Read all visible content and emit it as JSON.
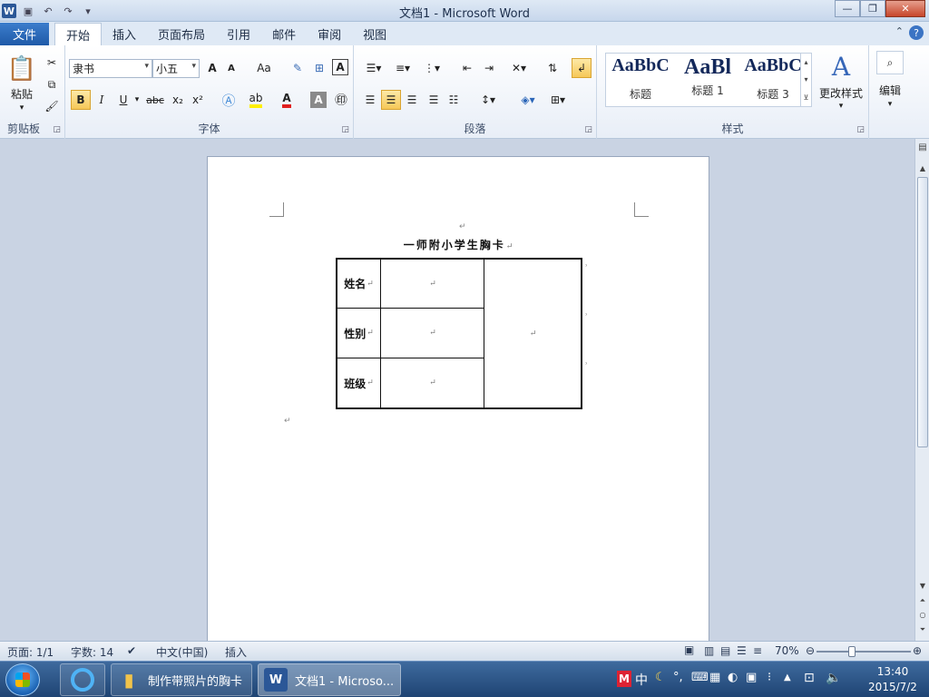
{
  "window": {
    "title": "文档1 - Microsoft Word",
    "app_icon": "W"
  },
  "ribbon_tabs": {
    "file": "文件",
    "items": [
      "开始",
      "插入",
      "页面布局",
      "引用",
      "邮件",
      "审阅",
      "视图"
    ],
    "active": "开始"
  },
  "clipboard": {
    "paste": "粘贴",
    "label": "剪贴板"
  },
  "font": {
    "family": "隶书",
    "size": "小五",
    "grow": "A",
    "shrink": "A",
    "case": "Aa",
    "clear": "A",
    "bold": "B",
    "italic": "I",
    "underline": "U",
    "strike": "abc",
    "sub": "x₂",
    "sup": "x²",
    "color_glyph": "A",
    "label": "字体"
  },
  "paragraph": {
    "label": "段落"
  },
  "styles": {
    "items": [
      {
        "preview": "AaBbC",
        "name": "标题"
      },
      {
        "preview": "AaBl",
        "name": "标题 1"
      },
      {
        "preview": "AaBbC",
        "name": "标题 3"
      }
    ],
    "change": "更改样式",
    "label": "样式"
  },
  "editing": {
    "label": "编辑"
  },
  "document": {
    "title": "一师附小学生胸卡",
    "rows": [
      {
        "label": "姓名"
      },
      {
        "label": "性别"
      },
      {
        "label": "班级"
      }
    ]
  },
  "statusbar": {
    "page": "页面: 1/1",
    "words": "字数: 14",
    "language": "中文(中国)",
    "mode": "插入",
    "zoom": "70%"
  },
  "taskbar": {
    "items": [
      {
        "label": "制作带照片的胸卡"
      },
      {
        "label": "文档1 - Microso..."
      }
    ],
    "ime": "中",
    "time": "13:40",
    "date": "2015/7/2"
  },
  "colors": {
    "accent": "#2b5797",
    "font_color_bar": "#e02020",
    "highlight_bar": "#ffef00"
  }
}
